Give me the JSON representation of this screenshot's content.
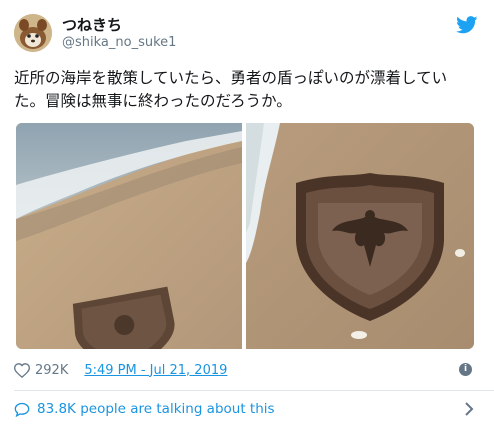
{
  "tweet": {
    "display_name": "つねきち",
    "handle": "@shika_no_suke1",
    "text": "近所の海岸を散策していたら、勇者の盾っぽいのが漂着していた。冒険は無事に終わったのだろうか。",
    "likes": "292K",
    "timestamp": "5:49 PM - Jul 21, 2019",
    "talking": "83.8K people are talking about this"
  },
  "icons": {
    "brand": "twitter-bird-icon",
    "like": "heart-icon",
    "info": "info-icon",
    "reply": "speech-bubble-icon",
    "chevron": "chevron-right-icon"
  },
  "colors": {
    "link": "#1b95e0",
    "muted": "#657786",
    "twitter_blue": "#1da1f2"
  }
}
